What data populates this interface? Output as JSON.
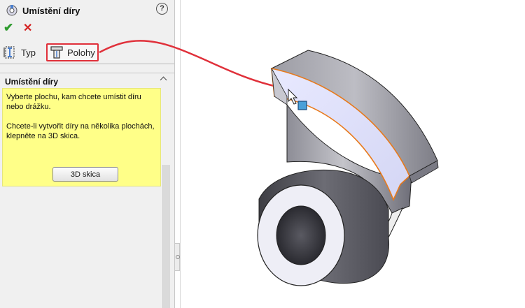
{
  "panel": {
    "title": "Umístění díry",
    "help_label": "?",
    "ok_symbol": "✔",
    "cancel_symbol": "✕",
    "tabs": [
      {
        "label": "Typ",
        "icon": "hole-type-icon"
      },
      {
        "label": "Polohy",
        "icon": "hole-positions-icon",
        "selected": true
      }
    ],
    "section": {
      "title": "Umístění díry",
      "message_1": "Vyberte plochu, kam chcete umístit díru nebo drážku.",
      "message_2": "Chcete-li vytvořit díry na několika plochách, klepněte na 3D skica.",
      "button_label": "3D skica"
    }
  },
  "colors": {
    "highlight_red": "#e0303a",
    "message_yellow": "#ffff88",
    "face_highlight": "#dfe0ff",
    "edge_orange": "#e87a1c"
  }
}
